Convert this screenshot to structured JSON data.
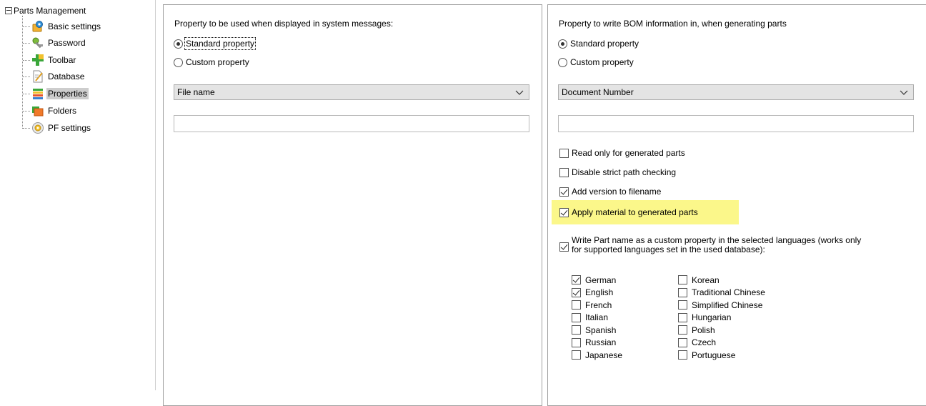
{
  "tree": {
    "root_label": "Parts Management",
    "items": [
      {
        "label": "Basic settings",
        "icon": "gear-settings-icon"
      },
      {
        "label": "Password",
        "icon": "key-icon"
      },
      {
        "label": "Toolbar",
        "icon": "toolbar-plus-icon"
      },
      {
        "label": "Database",
        "icon": "database-document-icon"
      },
      {
        "label": "Properties",
        "icon": "properties-list-icon",
        "selected": true
      },
      {
        "label": "Folders",
        "icon": "folders-icon"
      },
      {
        "label": "PF settings",
        "icon": "pf-settings-icon"
      }
    ]
  },
  "left_panel": {
    "title": "Property to be used when displayed in system messages:",
    "radio_standard": "Standard property",
    "radio_custom": "Custom property",
    "selected_radio": "standard",
    "dropdown_value": "File name",
    "text_value": ""
  },
  "right_panel": {
    "title": "Property to write BOM information in, when generating parts",
    "radio_standard": "Standard property",
    "radio_custom": "Custom property",
    "selected_radio": "standard",
    "dropdown_value": "Document Number",
    "text_value": "",
    "checkboxes": [
      {
        "label": "Read only for generated parts",
        "checked": false
      },
      {
        "label": "Disable strict path checking",
        "checked": false
      },
      {
        "label": "Add version to filename",
        "checked": true
      },
      {
        "label": "Apply material to generated parts",
        "checked": true,
        "highlighted": true
      }
    ],
    "write_part_name": {
      "label_line1": "Write Part name as a custom property in the selected languages (works only",
      "label_line2": "for supported languages set in the used database):",
      "checked": true
    },
    "languages_col1": [
      {
        "label": "German",
        "checked": true
      },
      {
        "label": "English",
        "checked": true
      },
      {
        "label": "French",
        "checked": false
      },
      {
        "label": "Italian",
        "checked": false
      },
      {
        "label": "Spanish",
        "checked": false
      },
      {
        "label": "Russian",
        "checked": false
      },
      {
        "label": "Japanese",
        "checked": false
      }
    ],
    "languages_col2": [
      {
        "label": "Korean",
        "checked": false
      },
      {
        "label": "Traditional Chinese",
        "checked": false
      },
      {
        "label": "Simplified Chinese",
        "checked": false
      },
      {
        "label": "Hungarian",
        "checked": false
      },
      {
        "label": "Polish",
        "checked": false
      },
      {
        "label": "Czech",
        "checked": false
      },
      {
        "label": "Portuguese",
        "checked": false
      }
    ]
  },
  "colors": {
    "highlight": "#fbf78a",
    "selection": "#cdcdcd",
    "combo_bg": "#e4e4e4"
  }
}
